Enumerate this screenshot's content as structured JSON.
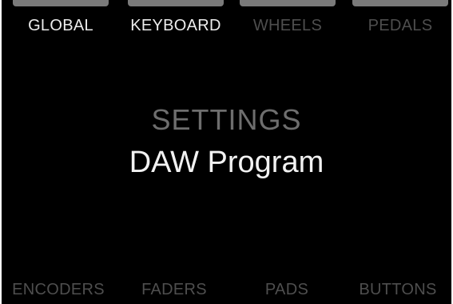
{
  "top_tabs": [
    {
      "label": "GLOBAL",
      "state": "active"
    },
    {
      "label": "KEYBOARD",
      "state": "active"
    },
    {
      "label": "WHEELS",
      "state": "dim"
    },
    {
      "label": "PEDALS",
      "state": "dim"
    }
  ],
  "main": {
    "heading": "SETTINGS",
    "value": "DAW Program"
  },
  "bottom_tabs": [
    {
      "label": "ENCODERS"
    },
    {
      "label": "FADERS"
    },
    {
      "label": "PADS"
    },
    {
      "label": "BUTTONS"
    }
  ],
  "colors": {
    "background": "#000000",
    "active_text": "#ececec",
    "dim_text": "#4e4e4e",
    "heading_text": "#6e6e6e",
    "tab_marker": "#7a7a7a"
  }
}
